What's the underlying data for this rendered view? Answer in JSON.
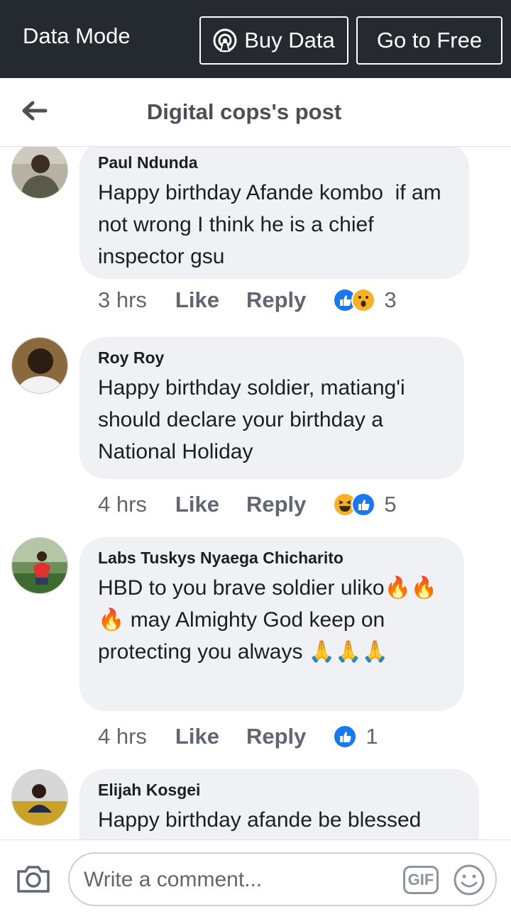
{
  "databar": {
    "mode_label": "Data Mode",
    "buy_label": "Buy Data",
    "free_label": "Go to Free"
  },
  "header": {
    "title": "Digital cops's post"
  },
  "comments": [
    {
      "name": "Paul Ndunda",
      "text": "Happy birthday Afande kombo  if am not wrong I think he is a chief inspector gsu",
      "time": "3 hrs",
      "like": "Like",
      "reply": "Reply",
      "reactions": [
        "like",
        "wow"
      ],
      "count": "3"
    },
    {
      "name": "Roy Roy",
      "text": "Happy birthday soldier, matiang'i should declare your birthday a National Holiday",
      "time": "4 hrs",
      "like": "Like",
      "reply": "Reply",
      "reactions": [
        "haha",
        "like"
      ],
      "count": "5"
    },
    {
      "name": "Labs Tuskys Nyaega Chicharito",
      "text": "HBD to you brave soldier uliko🔥🔥🔥 may Almighty God keep on protecting you always 🙏🙏🙏",
      "time": "4 hrs",
      "like": "Like",
      "reply": "Reply",
      "reactions": [
        "like"
      ],
      "count": "1"
    },
    {
      "name": "Elijah Kosgei",
      "text": "Happy birthday afande be blessed"
    }
  ],
  "composer": {
    "placeholder": "Write a comment...",
    "gif_label": "GIF"
  },
  "icons": {
    "back": "arrow-left-icon",
    "buy": "wireless-tower-icon",
    "camera": "camera-icon",
    "emoji": "smiley-icon"
  },
  "colors": {
    "bar": "#242a30",
    "bubble": "#f0f1f5",
    "like_blue": "#1877f2",
    "reaction_yellow": "#f7b125"
  }
}
